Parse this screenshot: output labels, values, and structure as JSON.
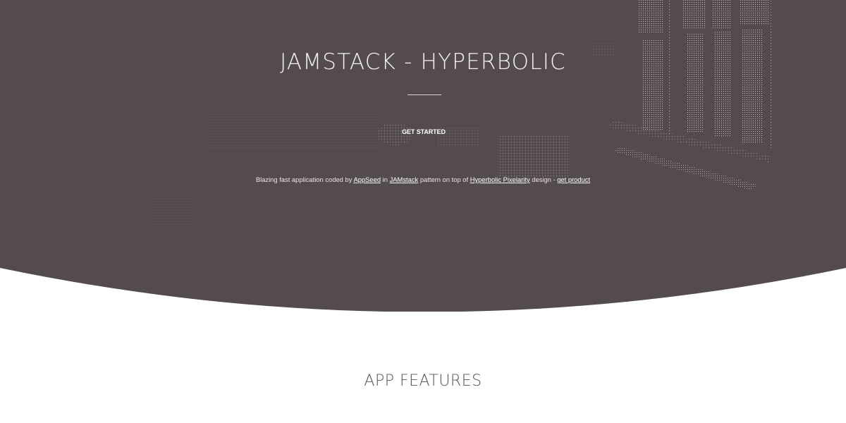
{
  "colors": {
    "hero_background": "#544b51",
    "hero_text": "#f4f1f3",
    "page_background": "#ffffff",
    "section_title": "#565055"
  },
  "hero": {
    "title": "JAMSTACK - HYPERBOLIC",
    "background_image": "pixelated-window-photo",
    "cta_label": "GET STARTED",
    "description": {
      "part1": "Blazing fast application coded by ",
      "link_appseed": "AppSeed",
      "part2": " in ",
      "link_jamstack": "JAMstack",
      "part3": " pattern on top of ",
      "link_hyperbolic": "Hyperbolic Pixelarity",
      "part4": " design - ",
      "link_get_product": "get product"
    }
  },
  "features": {
    "title": "APP FEATURES"
  }
}
